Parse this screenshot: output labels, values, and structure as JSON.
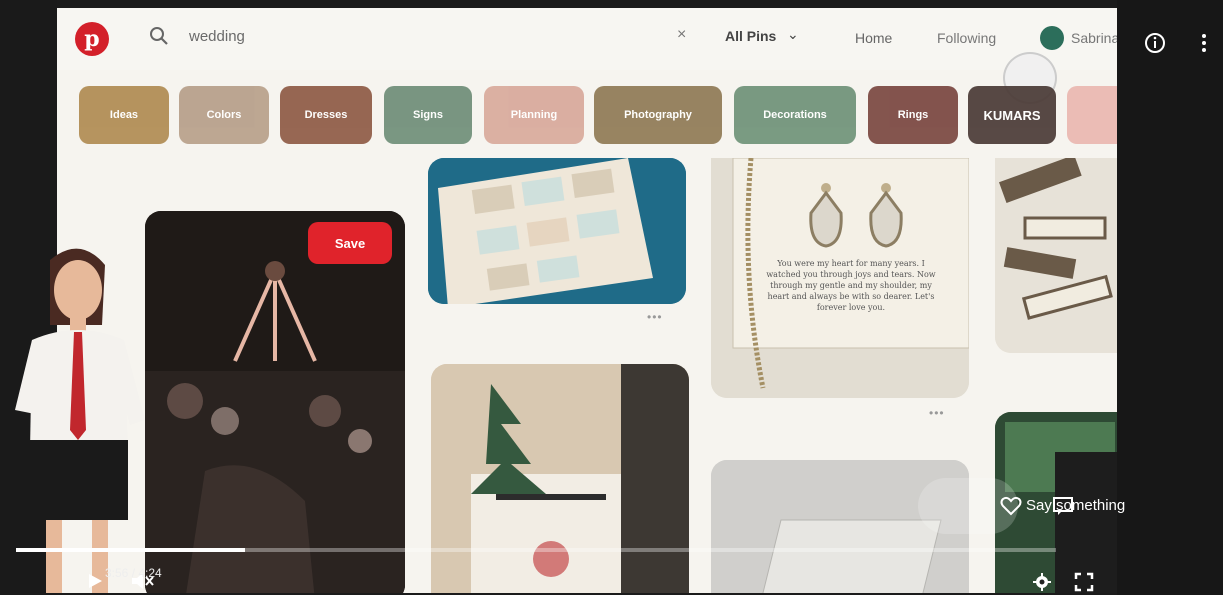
{
  "search": {
    "query": "wedding",
    "clear_symbol": "×"
  },
  "nav": {
    "filter_label": "All Pins",
    "filter_chevron": "⌄",
    "home": "Home",
    "following": "Following",
    "user": "Sabrina"
  },
  "logo": {
    "letter": "p",
    "color": "#d3202a"
  },
  "chips": [
    {
      "label": "Ideas",
      "color": "#b08b52"
    },
    {
      "label": "Colors",
      "color": "#b79f8a"
    },
    {
      "label": "Dresses",
      "color": "#8e5a45"
    },
    {
      "label": "Signs",
      "color": "#6f8e78"
    },
    {
      "label": "Planning",
      "color": "#d8a99b"
    },
    {
      "label": "Photography",
      "color": "#8f7a55"
    },
    {
      "label": "Decorations",
      "color": "#6f9278"
    },
    {
      "label": "Rings",
      "color": "#7a4640"
    },
    {
      "label": "KUMARS",
      "color": "#4a3a36"
    },
    {
      "label": "",
      "color": "#e9b6b0"
    }
  ],
  "video_pin": {
    "save_label": "Save",
    "save_color": "#e0232b"
  },
  "jewelry_pin": {
    "caption": "You were my heart for many years. I watched you through joys and tears. Now through my gentle and my shoulder, my heart and always be with so dearer. Let's forever love you."
  },
  "player": {
    "time": "3:56 / 4:24",
    "progress": 0.22,
    "say_something": "Say something",
    "icons": [
      "play-icon",
      "volume-icon",
      "info-icon",
      "more-icon",
      "heart-icon",
      "comment-icon",
      "settings-icon",
      "fullscreen-icon"
    ]
  }
}
